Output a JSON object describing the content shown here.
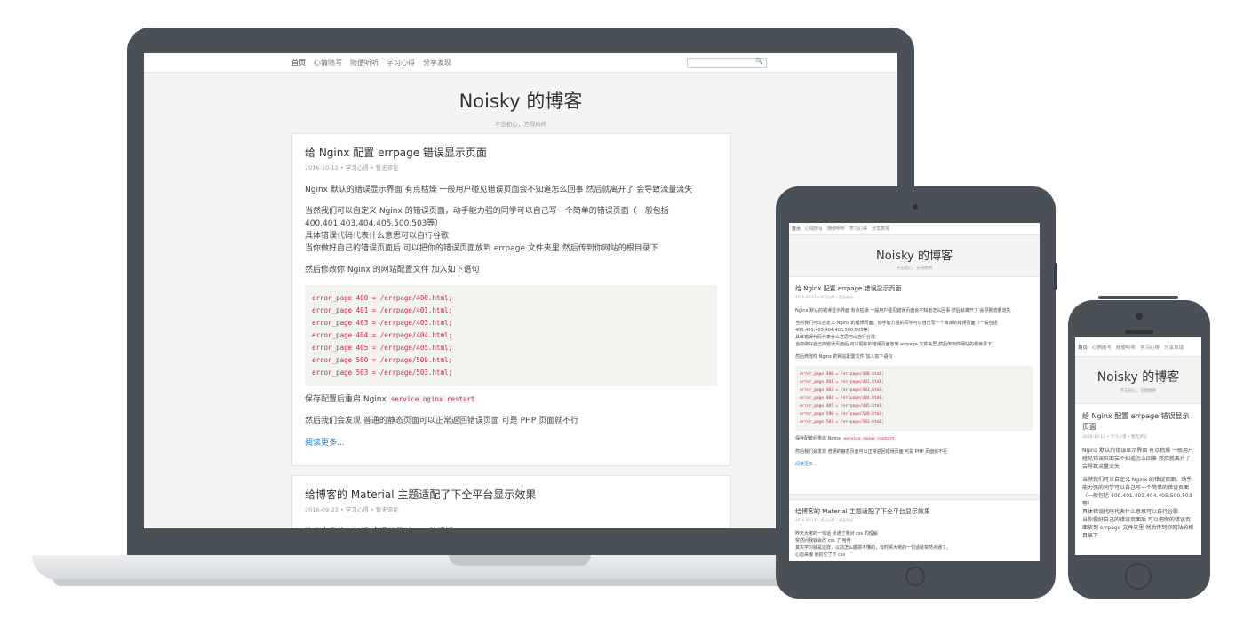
{
  "nav": {
    "items": [
      "首页",
      "心情随写",
      "随便听听",
      "学习心得",
      "分享发现"
    ],
    "search_icon": "🔍"
  },
  "site": {
    "title": "Noisky 的博客",
    "subtitle": "不忘初心，方得始终"
  },
  "post1": {
    "title": "给 Nginx 配置 errpage 错误显示页面",
    "meta": "2016-10-12 • 学习心得 • 暂无评论",
    "p1": "Nginx 默认的错误显示界面 有点枯燥 一般用户碰见错误页面会不知道怎么回事 然后就离开了 会导致流量流失",
    "p2a": "当然我们可以自定义 Nginx 的错误页面，动手能力强的同学可以自己写一个简单的错误页面（一般包括 400,401,403,404,405,500,503等）",
    "p2b": "具体错误代码代表什么意思可以自行谷歌",
    "p2c": "当你做好自己的错误页面后 可以把你的错误页面放到 errpage 文件夹里 然后传到你网站的根目录下",
    "p3": "然后修改你 Nginx 的网站配置文件 加入如下语句",
    "code": [
      "error_page  400 = /errpage/400.html;",
      "error_page  401 = /errpage/401.html;",
      "error_page  403 = /errpage/403.html;",
      "error_page  404 = /errpage/404.html;",
      "error_page  405 = /errpage/405.html;",
      "error_page  500 = /errpage/500.html;",
      "error_page  503 = /errpage/503.html;"
    ],
    "p4_prefix": "保存配置后重启 Nginx",
    "p4_code": "service nginx restart",
    "p5": "然后我们会发现 普通的静态页面可以正常返回错误页面 可是 PHP 页面就不行",
    "read_more": "阅读更多..."
  },
  "post2": {
    "title": "给博客的 Material 主题适配了下全平台显示效果",
    "meta": "2016-09-23 • 学习心得 • 暂无评论",
    "l1": "昨天大佬的一句话 点通了我对 css 的理解",
    "l2": "突然间我就会改 css 了 哈哈",
    "l3": "其实学习就是这样，以前怎么都搞不懂的，有时候大佬的一句话就突然点通了。",
    "l4": "心血来潮 就把它了下 css"
  },
  "colors": {
    "device": "#4a5058",
    "link": "#2a7bbd",
    "code_text": "#c7254e"
  }
}
